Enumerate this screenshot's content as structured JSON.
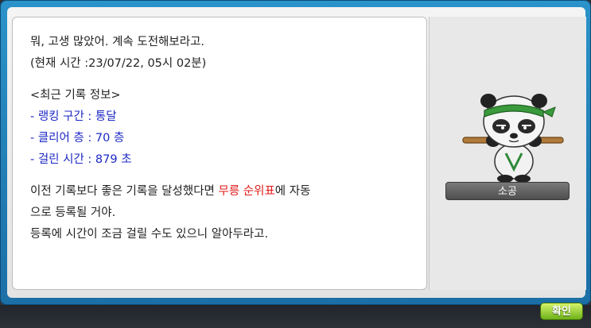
{
  "dialog": {
    "lines": [
      "뭐, 고생 많았어. 계속 도전해보라고.",
      "(현재 시간 :23/07/22, 05시 02분)"
    ],
    "record_header": "<최근 기록 정보>",
    "record_items": [
      "- 랭킹 구간 : 통달",
      "- 클리어 층 : 70 층",
      "- 걸린 시간 : 879 초"
    ],
    "notice_prefix": "이전 기록보다 좋은 기록을 달성했다면 ",
    "notice_highlight": "무릉 순위표",
    "notice_suffix": "에 자동",
    "notice_line2": "으로 등록될 거야.",
    "notice_line3": "등록에 시간이 조금 걸릴 수도 있으니 알아두라고."
  },
  "npc": {
    "name": "소공",
    "icon": "panda-npc-icon"
  },
  "buttons": {
    "ok_label": "확인"
  },
  "colors": {
    "record_text": "#1c28c4",
    "highlight_text": "#e21a1a",
    "ok_button": "#8fcc2a"
  }
}
